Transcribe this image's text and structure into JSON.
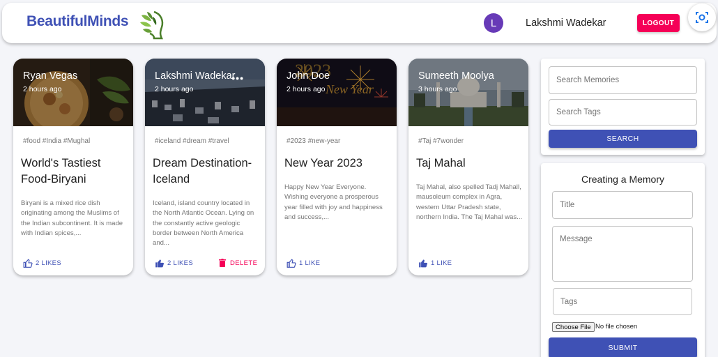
{
  "header": {
    "brand": "BeautifulMinds",
    "avatar_letter": "L",
    "username": "Lakshmi Wadekar",
    "logout_label": "LOGOUT"
  },
  "posts": [
    {
      "author": "Ryan Vegas",
      "time": "2 hours ago",
      "tags": "#food #India #Mughal",
      "title": "World's Tastiest Food-Biryani",
      "message": "Biryani is a mixed rice dish originating among the Muslims of the Indian subcontinent. It is made with Indian spices,...",
      "likes": "2 LIKES"
    },
    {
      "author": "Lakshmi Wadekar",
      "time": "2 hours ago",
      "more": "•••",
      "tags": "#iceland #dream #travel",
      "title": "Dream Destination-Iceland",
      "message": "Iceland, island country located in the North Atlantic Ocean. Lying on the constantly active geologic border between North America and...",
      "likes": "2 LIKES",
      "delete_label": "DELETE"
    },
    {
      "author": "John Doe",
      "time": "2 hours ago",
      "image_text": "2023",
      "image_text2": "New Year",
      "tags": "#2023 #new-year",
      "title": "New Year 2023",
      "message": "Happy New Year Everyone. Wishing everyone a prosperous year filled with joy and happiness and success,...",
      "likes": "1 LIKE"
    },
    {
      "author": "Sumeeth Moolya",
      "time": "3 hours ago",
      "tags": "#Taj #7wonder",
      "title": "Taj Mahal",
      "message": "Taj Mahal, also spelled Tadj Mahall, mausoleum complex in Agra, western Uttar Pradesh state, northern India. The Taj Mahal was...",
      "likes": "1 LIKE"
    }
  ],
  "search": {
    "memories_placeholder": "Search Memories",
    "tags_placeholder": "Search Tags",
    "button_label": "SEARCH"
  },
  "form": {
    "title": "Creating a Memory",
    "title_placeholder": "Title",
    "message_placeholder": "Message",
    "tags_placeholder": "Tags",
    "choose_file_label": "Choose File",
    "no_file_label": "No file chosen",
    "submit_label": "SUBMIT"
  },
  "colors": {
    "primary": "#3f51b5",
    "secondary": "#f50057",
    "avatar": "#673ab7"
  },
  "icons": {
    "like": "thumb-up-icon",
    "delete": "trash-icon",
    "screen": "screen-capture-icon",
    "logo": "leaf-head-logo"
  }
}
